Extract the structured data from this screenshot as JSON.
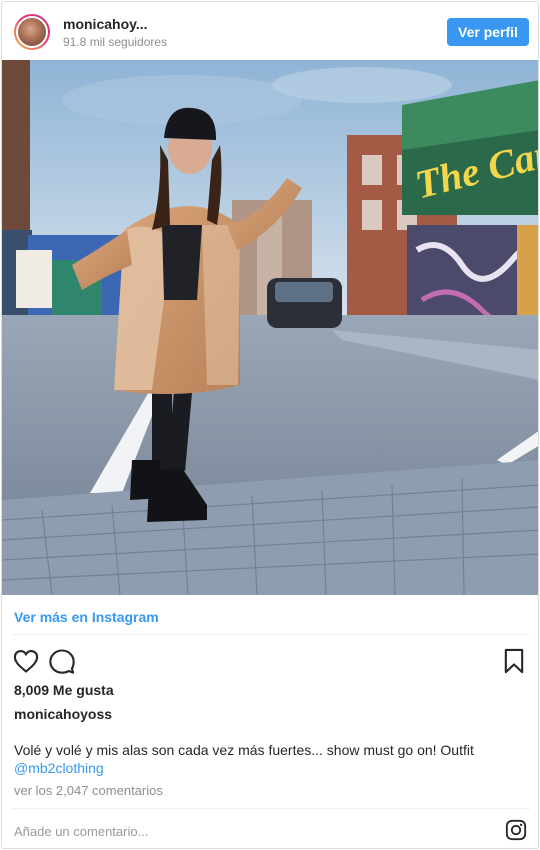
{
  "header": {
    "username": "monicahoy...",
    "followers": "91.8 mil seguidores",
    "follow_button": "Ver perfil"
  },
  "photo": {
    "sign_text": "The Camd"
  },
  "view_more_link": "Ver más en Instagram",
  "actions": {
    "like_icon": "heart-icon",
    "comment_icon": "comment-icon",
    "save_icon": "bookmark-icon"
  },
  "likes_text": "8,009 Me gusta",
  "caption": {
    "username": "monicahoyoss",
    "text": "Volé y volé y mis alas son cada vez más fuertes... show must go on! Outfit",
    "mention": "@mb2clothing"
  },
  "comments_link": "ver los 2,047 comentarios",
  "comment_box": {
    "placeholder": "Añade un comentario...",
    "icon": "instagram-icon"
  },
  "colors": {
    "accent": "#3897f0",
    "text": "#262626",
    "muted": "#8e8e8e",
    "border": "#dbdbdb"
  }
}
